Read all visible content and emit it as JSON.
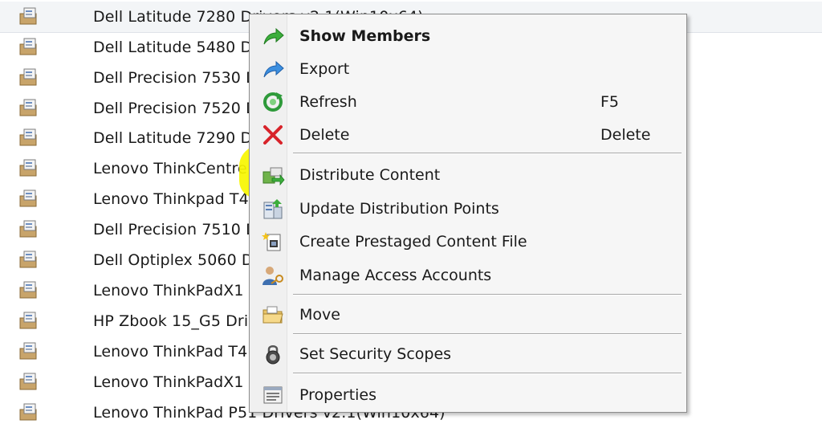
{
  "list": {
    "items": [
      {
        "label": "Dell Latitude 7280 Drivers v2.1(Win10x64)"
      },
      {
        "label": "Dell Latitude 5480 Drivers"
      },
      {
        "label": "Dell Precision 7530 Drivers"
      },
      {
        "label": "Dell Precision 7520 Drivers"
      },
      {
        "label": "Dell Latitude 7290 Drivers"
      },
      {
        "label": "Lenovo ThinkCentre Drivers"
      },
      {
        "label": "Lenovo Thinkpad T4 Drivers"
      },
      {
        "label": "Dell Precision 7510 Drivers"
      },
      {
        "label": "Dell Optiplex 5060 Drivers"
      },
      {
        "label": "Lenovo ThinkPadX1 Drivers"
      },
      {
        "label": "HP Zbook 15_G5 Drivers"
      },
      {
        "label": "Lenovo ThinkPad T4 Drivers"
      },
      {
        "label": "Lenovo ThinkPadX1 Drivers"
      },
      {
        "label": "Lenovo ThinkPad P51 Drivers v2.1(Win10x64)"
      }
    ]
  },
  "context_menu": {
    "items": [
      {
        "label": "Show Members",
        "shortcut": "",
        "icon": "green-arrow-icon"
      },
      {
        "label": "Export",
        "shortcut": "",
        "icon": "blue-arrow-icon"
      },
      {
        "label": "Refresh",
        "shortcut": "F5",
        "icon": "refresh-icon"
      },
      {
        "label": "Delete",
        "shortcut": "Delete",
        "icon": "red-x-icon"
      },
      {
        "label": "Distribute Content",
        "shortcut": "",
        "icon": "distribute-icon"
      },
      {
        "label": "Update Distribution Points",
        "shortcut": "",
        "icon": "update-dp-icon"
      },
      {
        "label": "Create Prestaged Content File",
        "shortcut": "",
        "icon": "prestaged-file-icon"
      },
      {
        "label": "Manage Access Accounts",
        "shortcut": "",
        "icon": "access-accounts-icon"
      },
      {
        "label": "Move",
        "shortcut": "",
        "icon": "folder-icon"
      },
      {
        "label": "Set Security Scopes",
        "shortcut": "",
        "icon": "lock-icon"
      },
      {
        "label": "Properties",
        "shortcut": "",
        "icon": "properties-icon"
      }
    ]
  },
  "colors": {
    "highlight": "#f7f600",
    "menu_background": "#f6f6f6"
  }
}
